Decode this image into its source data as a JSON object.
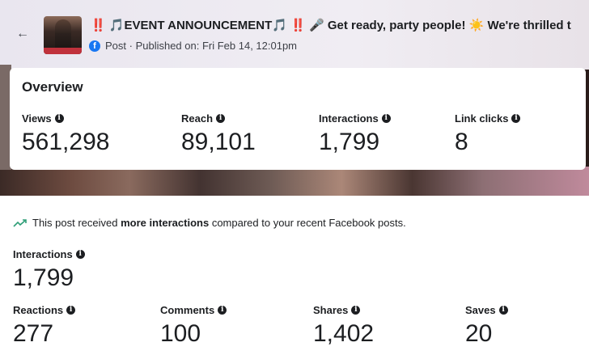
{
  "header": {
    "back_label": "←",
    "title": "‼️ 🎵EVENT ANNOUNCEMENT🎵 ‼️ 🎤 Get ready, party people! ☀️ We're thrilled t",
    "platform_icon": "facebook-icon",
    "meta": "Post · Published on: Fri Feb 14, 12:01pm"
  },
  "overview": {
    "title": "Overview",
    "stats": [
      {
        "label": "Views",
        "value": "561,298"
      },
      {
        "label": "Reach",
        "value": "89,101"
      },
      {
        "label": "Interactions",
        "value": "1,799"
      },
      {
        "label": "Link clicks",
        "value": "8"
      }
    ]
  },
  "insight": {
    "prefix": "This post received ",
    "emphasis": "more interactions",
    "suffix": " compared to your recent Facebook posts."
  },
  "interactions": {
    "label": "Interactions",
    "value": "1,799",
    "breakdown": [
      {
        "label": "Reactions",
        "value": "277"
      },
      {
        "label": "Comments",
        "value": "100"
      },
      {
        "label": "Shares",
        "value": "1,402"
      },
      {
        "label": "Saves",
        "value": "20"
      }
    ]
  },
  "colors": {
    "facebook_blue": "#1877f2",
    "trend_green": "#2e9e77"
  }
}
